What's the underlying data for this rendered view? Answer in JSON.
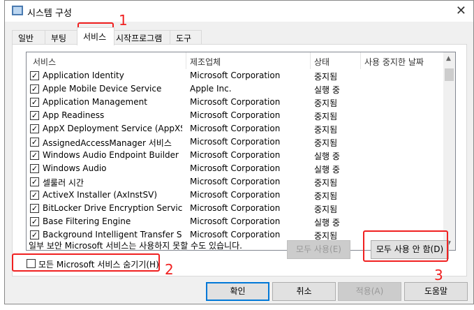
{
  "window": {
    "title": "시스템 구성"
  },
  "tabs": [
    {
      "label": "일반"
    },
    {
      "label": "부팅"
    },
    {
      "label": "서비스"
    },
    {
      "label": "시작프로그램"
    },
    {
      "label": "도구"
    }
  ],
  "columns": {
    "service": "서비스",
    "manufacturer": "제조업체",
    "status": "상태",
    "disabled_date": "사용 중지한 날짜"
  },
  "rows": [
    {
      "name": "Application Identity",
      "maker": "Microsoft Corporation",
      "status": "중지됨",
      "checked": true
    },
    {
      "name": "Apple Mobile Device Service",
      "maker": "Apple Inc.",
      "status": "실행 중",
      "checked": true
    },
    {
      "name": "Application Management",
      "maker": "Microsoft Corporation",
      "status": "중지됨",
      "checked": true
    },
    {
      "name": "App Readiness",
      "maker": "Microsoft Corporation",
      "status": "중지됨",
      "checked": true
    },
    {
      "name": "AppX Deployment Service (AppXSV...",
      "maker": "Microsoft Corporation",
      "status": "중지됨",
      "checked": true
    },
    {
      "name": "AssignedAccessManager 서비스",
      "maker": "Microsoft Corporation",
      "status": "중지됨",
      "checked": true
    },
    {
      "name": "Windows Audio Endpoint Builder",
      "maker": "Microsoft Corporation",
      "status": "실행 중",
      "checked": true
    },
    {
      "name": "Windows Audio",
      "maker": "Microsoft Corporation",
      "status": "실행 중",
      "checked": true
    },
    {
      "name": "셀룰러 시간",
      "maker": "Microsoft Corporation",
      "status": "중지됨",
      "checked": true
    },
    {
      "name": "ActiveX Installer (AxInstSV)",
      "maker": "Microsoft Corporation",
      "status": "중지됨",
      "checked": true
    },
    {
      "name": "BitLocker Drive Encryption Service",
      "maker": "Microsoft Corporation",
      "status": "중지됨",
      "checked": true
    },
    {
      "name": "Base Filtering Engine",
      "maker": "Microsoft Corporation",
      "status": "실행 중",
      "checked": true
    },
    {
      "name": "Background Intelligent Transfer Se...",
      "maker": "Microsoft Corporation",
      "status": "중지됨",
      "checked": true
    }
  ],
  "note": "일부 보안 Microsoft 서비스는 사용하지 못할 수도 있습니다.",
  "enable_all": "모두 사용(E)",
  "disable_all": "모두 사용 안 함(D)",
  "hide_ms": "모든 Microsoft 서비스 숨기기(H)",
  "buttons": {
    "ok": "확인",
    "cancel": "취소",
    "apply": "적용(A)",
    "help": "도움말"
  },
  "annotations": [
    "1",
    "2",
    "3"
  ]
}
